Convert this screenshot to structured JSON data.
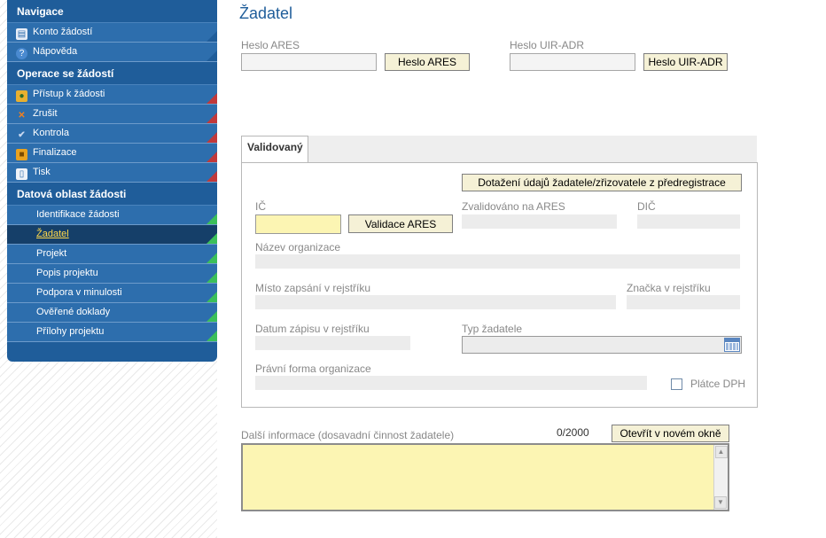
{
  "sidebar": {
    "nav_head": "Navigace",
    "nav_items": [
      {
        "label": "Konto žádostí"
      },
      {
        "label": "Nápověda"
      }
    ],
    "ops_head": "Operace se žádostí",
    "ops_items": [
      {
        "label": "Přístup k žádosti"
      },
      {
        "label": "Zrušit"
      },
      {
        "label": "Kontrola"
      },
      {
        "label": "Finalizace"
      },
      {
        "label": "Tisk"
      }
    ],
    "data_head": "Datová oblast žádosti",
    "data_items": [
      {
        "label": "Identifikace žádosti"
      },
      {
        "label": "Žadatel"
      },
      {
        "label": "Projekt"
      },
      {
        "label": "Popis projektu"
      },
      {
        "label": "Podpora v minulosti"
      },
      {
        "label": "Ověřené doklady"
      },
      {
        "label": "Přílohy projektu"
      }
    ]
  },
  "main": {
    "title": "Žadatel",
    "ares_label": "Heslo ARES",
    "ares_button": "Heslo ARES",
    "uir_label": "Heslo UIR-ADR",
    "uir_button": "Heslo UIR-ADR",
    "tab_label": "Validovaný",
    "prereg_button": "Dotažení údajů žadatele/zřizovatele z předregistrace",
    "ic_label": "IČ",
    "validate_button": "Validace ARES",
    "validated_label": "Zvalidováno na ARES",
    "dic_label": "DIČ",
    "org_name_label": "Název organizace",
    "registry_place_label": "Místo zapsání v rejstříku",
    "registry_mark_label": "Značka v rejstříku",
    "registry_date_label": "Datum zápisu v rejstříku",
    "applicant_type_label": "Typ žadatele",
    "legal_form_label": "Právní forma organizace",
    "vat_payer_label": "Plátce DPH",
    "more_info_label": "Další informace (dosavadní činnost žadatele)",
    "counter": "0/2000",
    "open_window_button": "Otevřít v novém okně"
  },
  "colors": {
    "accent": "#1f5d9a",
    "active_item": "#153f69",
    "ic_field": "#fcf5b3"
  }
}
